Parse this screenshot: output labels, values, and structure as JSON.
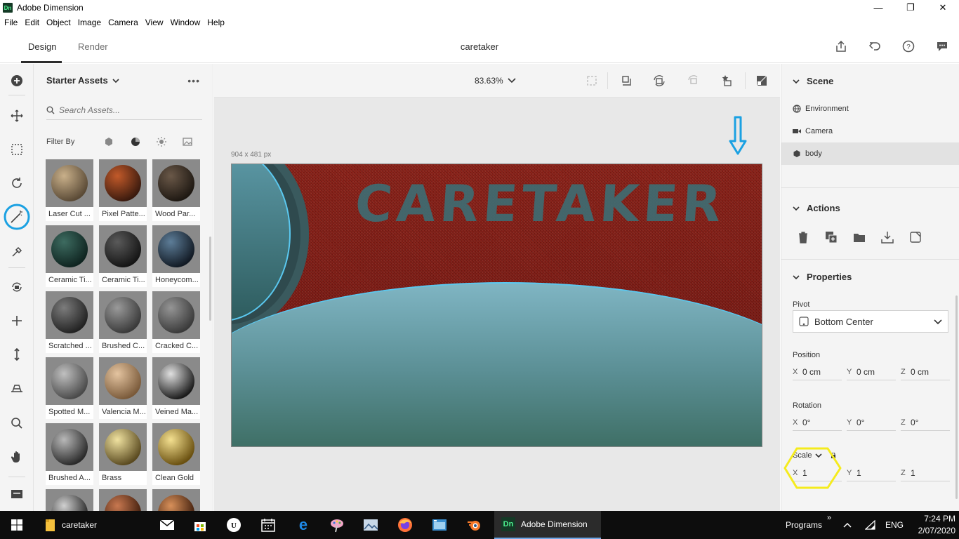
{
  "window": {
    "title": "Adobe Dimension",
    "app_badge": "Dn",
    "minimize": "—",
    "maximize": "❐",
    "close": "✕"
  },
  "menu": [
    "File",
    "Edit",
    "Object",
    "Image",
    "Camera",
    "View",
    "Window",
    "Help"
  ],
  "tabs": {
    "design": "Design",
    "render": "Render",
    "active": "Design"
  },
  "document": {
    "title": "caretaker"
  },
  "top_actions": [
    "share-icon",
    "undo-icon",
    "help-icon",
    "feedback-icon"
  ],
  "toolbar": {
    "tools": [
      "add-icon",
      "select-move-icon",
      "marquee-select-icon",
      "orbit-icon",
      "magic-wand-icon",
      "sample-icon",
      "rotate-camera-icon",
      "pan-camera-icon",
      "dolly-camera-icon",
      "horizon-icon",
      "zoom-icon",
      "hand-icon",
      "panel-toggle-icon"
    ],
    "highlighted_tool": "magic-wand-icon",
    "highlight_color": "#1ba1e2"
  },
  "assets": {
    "title": "Starter Assets",
    "search_placeholder": "Search Assets...",
    "filter_label": "Filter By",
    "filters": [
      "models-filter-icon",
      "materials-filter-icon",
      "lights-filter-icon",
      "images-filter-icon"
    ],
    "items": [
      {
        "label": "Laser Cut ...",
        "color_a": "#c9b08a",
        "color_b": "#5a4a36"
      },
      {
        "label": "Pixel Patte...",
        "color_a": "#c25a2a",
        "color_b": "#3a1a0e"
      },
      {
        "label": "Wood Par...",
        "color_a": "#6a5848",
        "color_b": "#1e1812"
      },
      {
        "label": "Ceramic Ti...",
        "color_a": "#3d6b60",
        "color_b": "#0f2420"
      },
      {
        "label": "Ceramic Ti...",
        "color_a": "#5a5a5a",
        "color_b": "#151515"
      },
      {
        "label": "Honeycom...",
        "color_a": "#5d7d98",
        "color_b": "#121a24"
      },
      {
        "label": "Scratched ...",
        "color_a": "#7c7c7c",
        "color_b": "#222222"
      },
      {
        "label": "Brushed C...",
        "color_a": "#9a9a9a",
        "color_b": "#3a3a3a"
      },
      {
        "label": "Cracked C...",
        "color_a": "#959595",
        "color_b": "#3a3a3a"
      },
      {
        "label": "Spotted M...",
        "color_a": "#c0c0c0",
        "color_b": "#4a4a4a"
      },
      {
        "label": "Valencia M...",
        "color_a": "#e4c4a0",
        "color_b": "#7a5a3a"
      },
      {
        "label": "Veined Ma...",
        "color_a": "#e0e0e0",
        "color_b": "#1a1a1a"
      },
      {
        "label": "Brushed A...",
        "color_a": "#b8b8b8",
        "color_b": "#2a2a2a"
      },
      {
        "label": "Brass",
        "color_a": "#f0e2a0",
        "color_b": "#5a4a20"
      },
      {
        "label": "Clean Gold",
        "color_a": "#f4e090",
        "color_b": "#6a5010"
      },
      {
        "label": "",
        "color_a": "#d0d0d0",
        "color_b": "#222222"
      },
      {
        "label": "",
        "color_a": "#c87850",
        "color_b": "#3a1a0a"
      },
      {
        "label": "",
        "color_a": "#d8905a",
        "color_b": "#3a1a0a"
      }
    ]
  },
  "canvas": {
    "zoom": "83.63%",
    "dimensions": "904 x 481 px",
    "headline": "CARETAKER",
    "arrow_color": "#1ba1e2",
    "tools": [
      "fit-frame-icon",
      "place-on-ground-icon",
      "rotate-object-icon",
      "reset-icon",
      "favorite-view-icon",
      "render-preview-icon"
    ]
  },
  "scene": {
    "title": "Scene",
    "items": [
      {
        "label": "Environment",
        "icon": "globe-icon"
      },
      {
        "label": "Camera",
        "icon": "video-camera-icon"
      },
      {
        "label": "body",
        "icon": "cube-icon",
        "selected": true
      }
    ]
  },
  "actions": {
    "title": "Actions",
    "icons": [
      "delete-icon",
      "duplicate-icon",
      "group-icon",
      "import-icon",
      "save-view-icon"
    ]
  },
  "properties": {
    "title": "Properties",
    "pivot_label": "Pivot",
    "pivot_value": "Bottom Center",
    "position_label": "Position",
    "position": {
      "x": "0 cm",
      "y": "0 cm",
      "z": "0 cm"
    },
    "rotation_label": "Rotation",
    "rotation": {
      "x": "0°",
      "y": "0°",
      "z": "0°"
    },
    "scale_label": "Scale",
    "scale": {
      "x": "1",
      "y": "1",
      "z": "1"
    },
    "scale_highlight_color": "#f5eb1d"
  },
  "taskbar": {
    "folder_label": "caretaker",
    "active_app": "Adobe Dimension",
    "active_app_badge": "Dn",
    "programs": "Programs",
    "programs_chevron": "»",
    "language": "ENG",
    "time": "7:24 PM",
    "date": "2/07/2020"
  }
}
